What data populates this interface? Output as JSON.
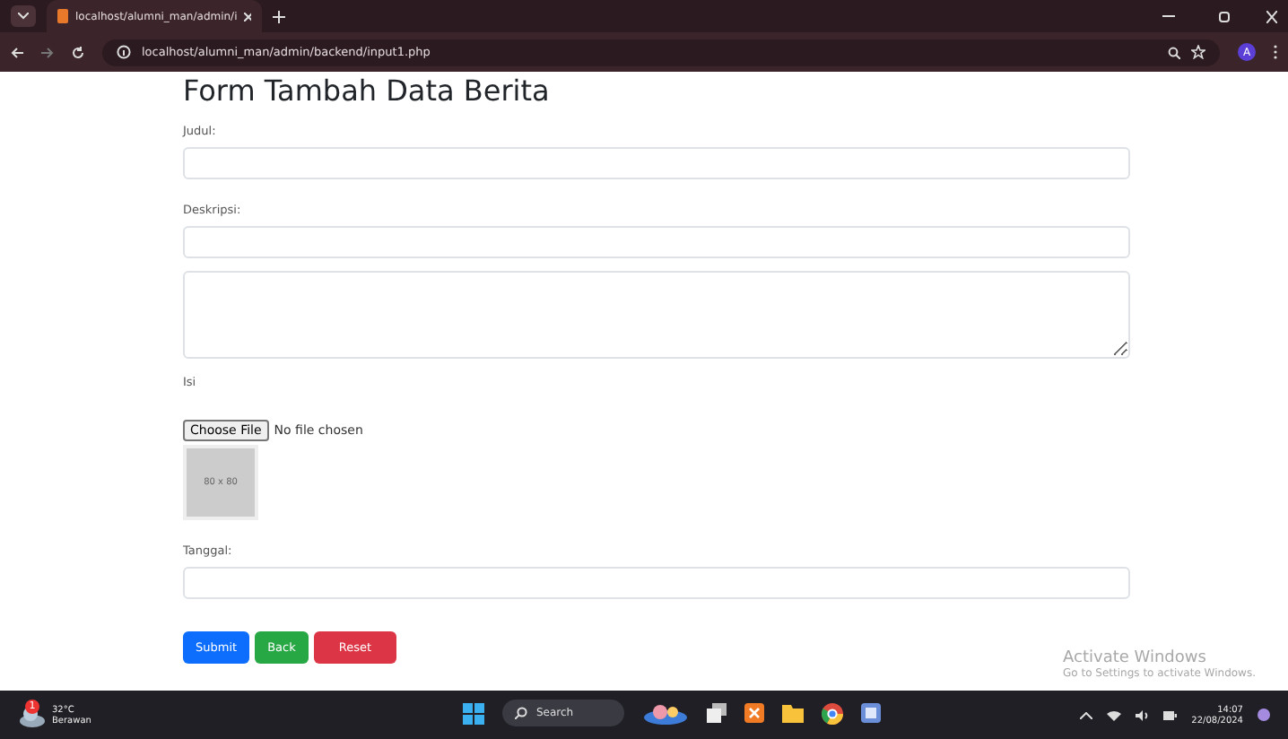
{
  "browser": {
    "tab_title": "localhost/alumni_man/admin/i",
    "url": "localhost/alumni_man/admin/backend/input1.php",
    "profile": "A"
  },
  "page": {
    "title": "Form Tambah Data Berita",
    "fields": [
      {
        "kind": "text",
        "label": "Judul:"
      },
      {
        "kind": "text",
        "label": "Deskripsi:"
      },
      {
        "kind": "textarea",
        "label": "Isi"
      },
      {
        "kind": "file",
        "button": "Choose File",
        "status": "No file chosen",
        "thumbnail": "80 x 80"
      },
      {
        "kind": "text",
        "label": "Tanggal:"
      }
    ],
    "buttons": [
      {
        "label": "Submit",
        "color": "#0d6efd"
      },
      {
        "label": "Back",
        "color": "#28a745"
      },
      {
        "label": "Reset",
        "color": "#dc3545"
      }
    ]
  },
  "activation": {
    "title": "Activate Windows",
    "subtitle": "Go to Settings to activate Windows."
  },
  "taskbar": {
    "temperature": "32°C",
    "weather": "Berawan",
    "badge": "1",
    "search": "Search",
    "time": "14:07",
    "date": "22/08/2024"
  }
}
